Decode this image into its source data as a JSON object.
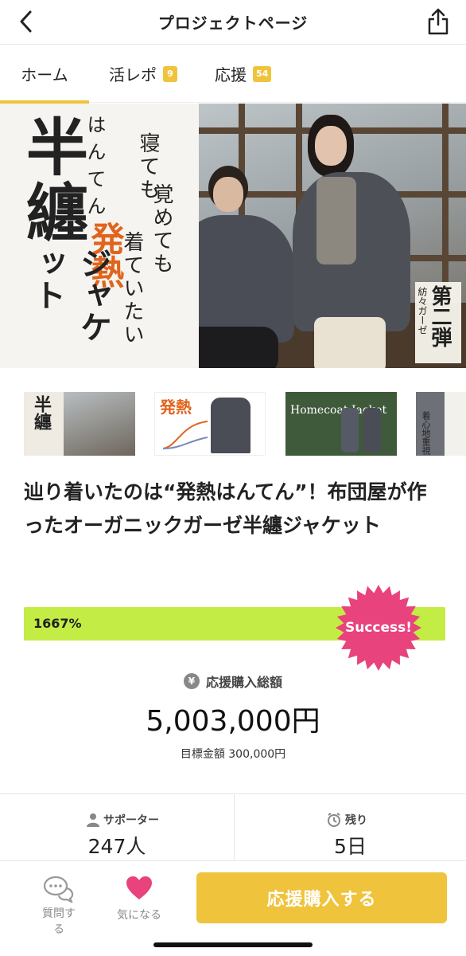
{
  "header": {
    "title": "プロジェクトページ",
    "back_icon": "chevron-left-icon",
    "share_icon": "share-icon"
  },
  "tabs": [
    {
      "label": "ホーム",
      "badge": null,
      "active": true
    },
    {
      "label": "活レポ",
      "badge": "9",
      "active": false
    },
    {
      "label": "応援",
      "badge": "54",
      "active": false
    }
  ],
  "hero": {
    "big_kanji": "半纏",
    "hanten": "はんてん",
    "hatsunetsu": "発熱",
    "jacket": "ジャケット",
    "copy_1": "寝ても",
    "copy_2": "覚めても",
    "copy_3": "着ていたい",
    "seal_small": "紡々ガーゼ",
    "seal_big": "第二弾"
  },
  "thumbnails": [
    {
      "caption": "半纏"
    },
    {
      "caption": "発熱"
    },
    {
      "caption": "Homecoat Jacket"
    },
    {
      "caption": "着心地重視"
    }
  ],
  "project": {
    "title": "辿り着いたのは“発熱はんてん”！布団屋が作ったオーガニックガーゼ半纏ジャケット"
  },
  "progress": {
    "percent_label": "1667%",
    "fill_fraction": 1.0,
    "success_label": "Success!",
    "accent_color": "#c3ec45",
    "success_color": "#e8437c"
  },
  "funding": {
    "label": "応援購入総額",
    "amount": "5,003,000円",
    "goal": "目標金額 300,000円"
  },
  "stats": {
    "supporters_label": "サポーター",
    "supporters_value": "247人",
    "remaining_label": "残り",
    "remaining_value": "5日"
  },
  "bottom": {
    "question_label": "質問する",
    "favorite_label": "気になる",
    "buy_label": "応援購入する",
    "brand_color": "#f0c33c"
  }
}
